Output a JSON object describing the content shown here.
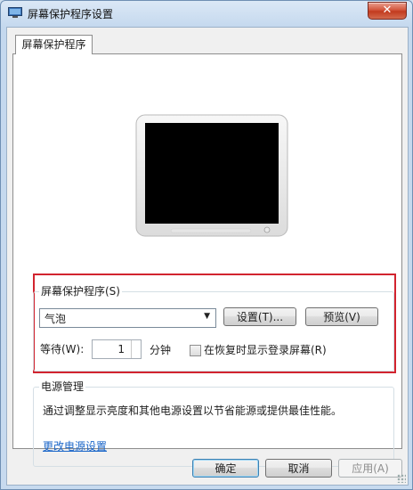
{
  "window": {
    "title": "屏幕保护程序设置",
    "close_glyph": "✕"
  },
  "tabs": [
    {
      "label": "屏幕保护程序"
    }
  ],
  "screensaver_group": {
    "label": "屏幕保护程序(S)",
    "selected": "气泡",
    "settings_button": "设置(T)...",
    "preview_button": "预览(V)",
    "wait_label": "等待(W):",
    "wait_value": "1",
    "wait_unit": "分钟",
    "resume_checkbox_label": "在恢复时显示登录屏幕(R)",
    "resume_checked": false
  },
  "power_group": {
    "label": "电源管理",
    "description": "通过调整显示亮度和其他电源设置以节省能源或提供最佳性能。",
    "link": "更改电源设置"
  },
  "footer": {
    "ok_button": "确定",
    "cancel_button": "取消",
    "apply_button": "应用(A)"
  },
  "colors": {
    "highlight_border": "#d2242f",
    "link": "#1a66c9"
  }
}
